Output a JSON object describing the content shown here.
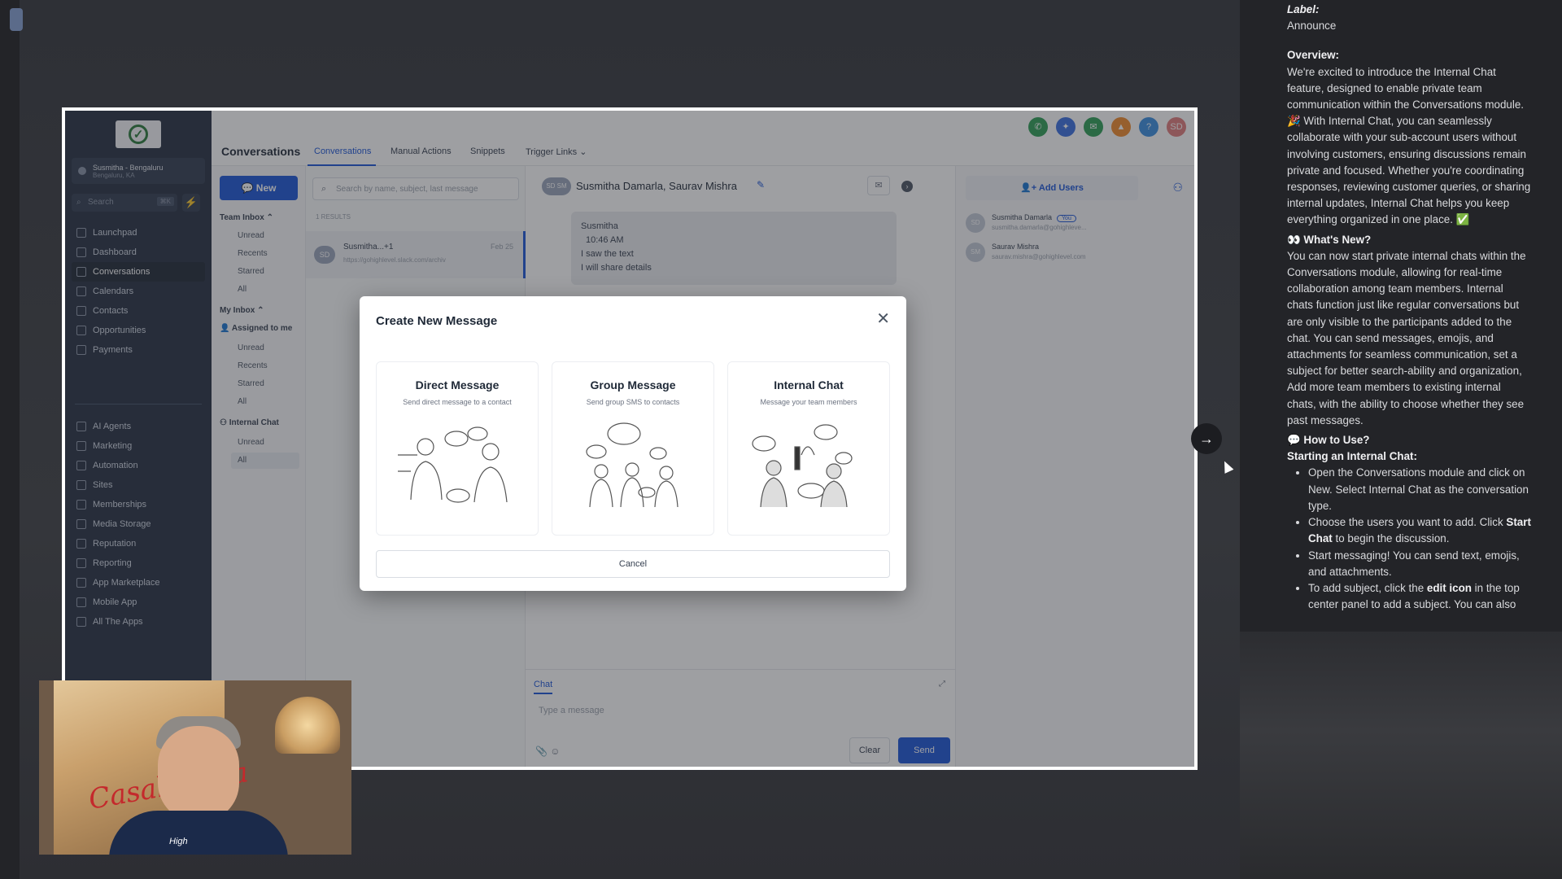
{
  "sidebar": {
    "account_name": "Susmitha - Bengaluru",
    "account_sub": "Bengaluru, KA",
    "search_placeholder": "Search",
    "search_shortcut": "⌘K",
    "items": [
      {
        "label": "Launchpad"
      },
      {
        "label": "Dashboard"
      },
      {
        "label": "Conversations"
      },
      {
        "label": "Calendars"
      },
      {
        "label": "Contacts"
      },
      {
        "label": "Opportunities"
      },
      {
        "label": "Payments"
      },
      {
        "label": "AI Agents"
      },
      {
        "label": "Marketing"
      },
      {
        "label": "Automation"
      },
      {
        "label": "Sites"
      },
      {
        "label": "Memberships"
      },
      {
        "label": "Media Storage"
      },
      {
        "label": "Reputation"
      },
      {
        "label": "Reporting"
      },
      {
        "label": "App Marketplace"
      },
      {
        "label": "Mobile App"
      },
      {
        "label": "All The Apps"
      }
    ]
  },
  "topbar": {
    "title": "Conversations",
    "tabs": [
      "Conversations",
      "Manual Actions",
      "Snippets",
      "Trigger Links"
    ],
    "avatar_initials": "SD",
    "help": "?"
  },
  "inbox": {
    "new_label": "New",
    "team_inbox": "Team Inbox",
    "team_items": [
      "Unread",
      "Recents",
      "Starred",
      "All"
    ],
    "my_inbox": "My Inbox",
    "assigned": "Assigned to me",
    "my_items": [
      "Unread",
      "Recents",
      "Starred",
      "All"
    ],
    "internal_chat": "Internal Chat",
    "internal_items": [
      "Unread",
      "All"
    ]
  },
  "convlist": {
    "search_placeholder": "Search by name, subject, last message",
    "count": "1 RESULTS",
    "item": {
      "avatar": "SD",
      "name": "Susmitha...+1",
      "snippet": "https://gohighlevel.slack.com/archiv",
      "date": "Feb 25"
    }
  },
  "chat": {
    "avatars": "SD SM",
    "participants": "Susmitha Damarla, Saurav Mishra",
    "bubble": {
      "sender": "Susmitha",
      "time": "10:46 AM",
      "line1": "I saw the text",
      "line2": "I will share details"
    },
    "composer_tab": "Chat",
    "placeholder": "Type a message",
    "clear": "Clear",
    "send": "Send"
  },
  "users_panel": {
    "add_users": "Add Users",
    "users": [
      {
        "avatar": "SD",
        "name": "Susmitha Damarla",
        "badge": "You",
        "email": "susmitha.damarla@gohighleve..."
      },
      {
        "avatar": "SM",
        "name": "Saurav Mishra",
        "badge": "",
        "email": "saurav.mishra@gohighlevel.com"
      }
    ]
  },
  "modal": {
    "title": "Create New Message",
    "cards": [
      {
        "title": "Direct Message",
        "desc": "Send direct message to a contact"
      },
      {
        "title": "Group Message",
        "desc": "Send group SMS to contacts"
      },
      {
        "title": "Internal Chat",
        "desc": "Message your team members"
      }
    ],
    "cancel": "Cancel"
  },
  "webcam": {
    "poster_text": "Casablanca",
    "shirt_text": "High"
  },
  "notes": {
    "label_heading": "Label:",
    "label_value": "Announce",
    "overview_heading": "Overview:",
    "overview_text": "We're excited to introduce the Internal Chat feature, designed to enable private team communication within the Conversations module. 🎉 With Internal Chat, you can seamlessly collaborate with your sub-account users without involving customers, ensuring discussions remain private and focused. Whether you're coordinating responses, reviewing customer queries, or sharing internal updates, Internal Chat helps you keep everything organized in one place. ✅",
    "whats_new_heading": "👀 What's New?",
    "whats_new_text": "You can now start private internal chats within the Conversations module, allowing for real-time collaboration among team members. Internal chats function just like regular conversations but are only visible to the participants added to the chat. You can send messages, emojis, and attachments for seamless communication, set a subject for better search-ability and organization, Add more team members to existing internal chats, with the ability to choose whether they see past messages.",
    "how_to_heading": "💬 How to Use?",
    "starting_heading": "Starting an Internal Chat:",
    "bullet1": "Open the Conversations module and click on New. Select Internal Chat as the conversation type.",
    "bullet2_a": "Choose the users you want to add. Click ",
    "bullet2_b": "Start Chat",
    "bullet2_c": " to begin the discussion.",
    "bullet3": "Start messaging! You can send text, emojis, and attachments.",
    "bullet4_a": "To add subject, click the ",
    "bullet4_b": "edit icon",
    "bullet4_c": " in the top center panel to add a subject. You can also"
  },
  "colors": {
    "accent": "#1d56d8",
    "sidebar": "#273142",
    "background": "#2a2b2f"
  }
}
